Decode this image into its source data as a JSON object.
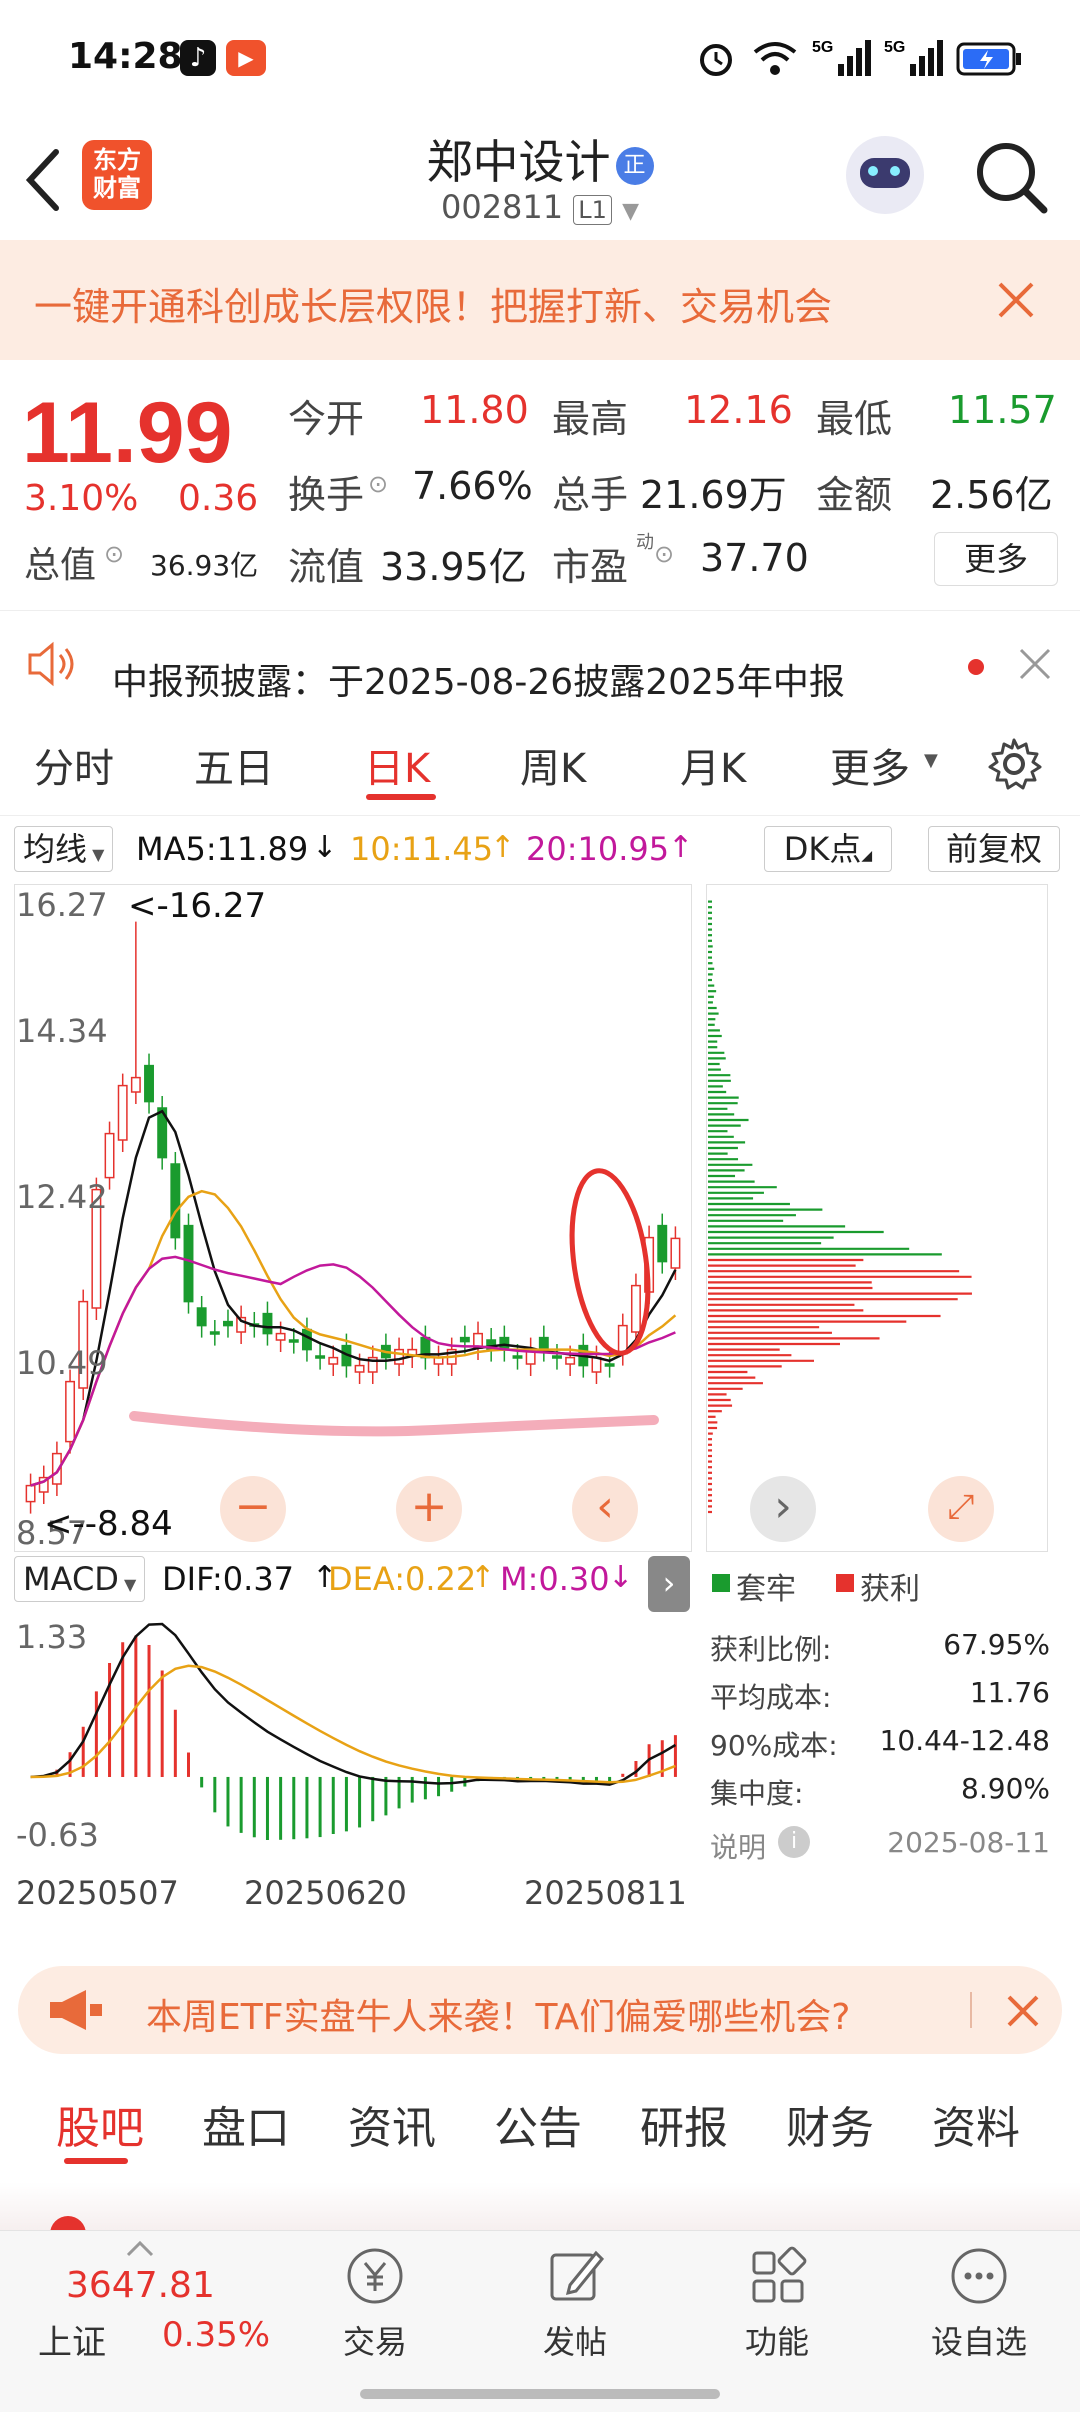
{
  "status_bar": {
    "time": "14:28",
    "icons": [
      "tiktok-icon",
      "video-icon",
      "alarm-icon",
      "wifi-icon",
      "signal-5g-icon",
      "signal-5g-icon",
      "battery-icon"
    ]
  },
  "nav": {
    "logo_line1": "东方",
    "logo_line2": "财富",
    "title": "郑中设计",
    "title_badge": "正",
    "code": "002811",
    "level": "L1"
  },
  "banner": {
    "text": "一键开通科创成长层权限！把握打新、交易机会"
  },
  "quote": {
    "price": "11.99",
    "change_pct": "3.10%",
    "change": "0.36",
    "rows": [
      [
        {
          "label": "今开",
          "value": "11.80",
          "color": "red"
        },
        {
          "label": "最高",
          "value": "12.16",
          "color": "red"
        },
        {
          "label": "最低",
          "value": "11.57",
          "color": "green"
        }
      ],
      [
        {
          "label": "换手",
          "value": "7.66%",
          "color": "black"
        },
        {
          "label": "总手",
          "value": "21.69万",
          "color": "black"
        },
        {
          "label": "金额",
          "value": "2.56亿",
          "color": "black"
        }
      ]
    ],
    "row3": {
      "total_value_label": "总值",
      "total_value": "36.93亿",
      "float_label": "流值",
      "float_value": "33.95亿",
      "pe_label": "市盈",
      "pe_sup": "动",
      "pe_value": "37.70",
      "more": "更多"
    }
  },
  "notice": {
    "text": "中报预披露：于2025-08-26披露2025年中报"
  },
  "tabs": [
    "分时",
    "五日",
    "日K",
    "周K",
    "月K",
    "更多"
  ],
  "active_tab": 2,
  "ma_bar": {
    "selector": "均线",
    "ma5": "MA5:11.89",
    "ma10": "10:11.45",
    "ma20": "20:10.95",
    "dk": "DK点",
    "fq": "前复权"
  },
  "kline": {
    "y_labels": [
      "16.27",
      "14.34",
      "12.42",
      "10.49",
      "8.57"
    ],
    "max_marker": "<-16.27",
    "min_marker": "<--8.84"
  },
  "macd": {
    "selector": "MACD",
    "dif": "DIF:0.37",
    "dea": "DEA:0.22",
    "m": "M:0.30",
    "y_top": "1.33",
    "y_bottom": "-0.63"
  },
  "x_dates": [
    "20250507",
    "20250620",
    "20250811"
  ],
  "chip": {
    "legend_trapped": "套牢",
    "legend_profit": "获利",
    "rows": [
      {
        "label": "获利比例:",
        "value": "67.95%"
      },
      {
        "label": "平均成本:",
        "value": "11.76"
      },
      {
        "label": "90%成本:",
        "value": "10.44-12.48"
      },
      {
        "label": "集中度:",
        "value": "8.90%"
      }
    ],
    "note_label": "说明",
    "date": "2025-08-11"
  },
  "promo": {
    "text": "本周ETF实盘牛人来袭！TA们偏爱哪些机会?"
  },
  "bottom_tabs": [
    "股吧",
    "盘口",
    "资讯",
    "公告",
    "研报",
    "财务",
    "资料"
  ],
  "footer": {
    "index_value": "3647.81",
    "index_name": "上证",
    "index_change": "0.35%",
    "buttons": [
      "交易",
      "发帖",
      "功能",
      "设自选"
    ]
  },
  "colors": {
    "up": "#e5322d",
    "down": "#1a9b2e",
    "accent": "#e86a3a",
    "ma10": "#e8a215",
    "ma20": "#c2189b"
  },
  "chart_data": {
    "type": "candlestick",
    "date_range": [
      "20250507",
      "20250811"
    ],
    "approx_close": [
      8.9,
      9.0,
      9.3,
      10.2,
      11.2,
      12.6,
      13.3,
      13.9,
      14.0,
      13.7,
      13.0,
      12.0,
      11.2,
      10.9,
      10.8,
      10.9,
      11.0,
      10.9,
      10.8,
      10.8,
      10.7,
      10.6,
      10.5,
      10.5,
      10.4,
      10.4,
      10.5,
      10.5,
      10.6,
      10.6,
      10.5,
      10.5,
      10.6,
      10.7,
      10.8,
      10.6,
      10.6,
      10.5,
      10.6,
      10.6,
      10.5,
      10.5,
      10.4,
      10.5,
      10.4,
      10.9,
      11.4,
      12.0,
      11.7,
      11.99
    ],
    "ylim": [
      8.57,
      16.27
    ]
  }
}
